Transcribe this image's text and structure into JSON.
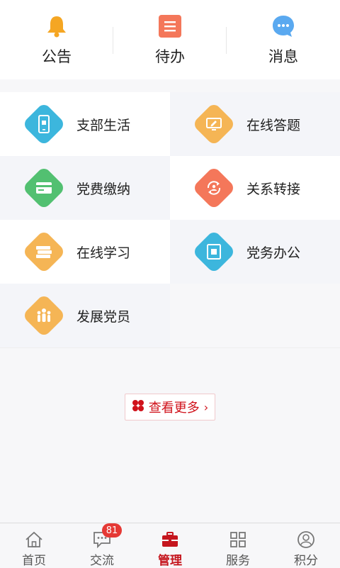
{
  "top": {
    "items": [
      {
        "label": "公告",
        "icon": "bell-icon",
        "color": "#f5a623"
      },
      {
        "label": "待办",
        "icon": "todo-list-icon",
        "color": "#f4775a"
      },
      {
        "label": "消息",
        "icon": "message-bubble-icon",
        "color": "#5aa9f0"
      }
    ]
  },
  "grid": {
    "items": [
      {
        "label": "支部生活",
        "icon": "phone-party-icon",
        "color": "#3cb6dd"
      },
      {
        "label": "在线答题",
        "icon": "pencil-screen-icon",
        "color": "#f5b555"
      },
      {
        "label": "党费缴纳",
        "icon": "card-icon",
        "color": "#52c071"
      },
      {
        "label": "关系转接",
        "icon": "transfer-icon",
        "color": "#f4775a"
      },
      {
        "label": "在线学习",
        "icon": "books-icon",
        "color": "#f5b555"
      },
      {
        "label": "党务办公",
        "icon": "office-flag-icon",
        "color": "#3cb6dd"
      },
      {
        "label": "发展党员",
        "icon": "people-icon",
        "color": "#f5b555"
      }
    ]
  },
  "more": {
    "label": "查看更多",
    "accent": "#d0121b"
  },
  "nav": {
    "items": [
      {
        "label": "首页",
        "icon": "home-icon"
      },
      {
        "label": "交流",
        "icon": "chat-icon",
        "badge": "81"
      },
      {
        "label": "管理",
        "icon": "briefcase-icon",
        "active": true
      },
      {
        "label": "服务",
        "icon": "grid-icon"
      },
      {
        "label": "积分",
        "icon": "user-circle-icon"
      }
    ]
  }
}
